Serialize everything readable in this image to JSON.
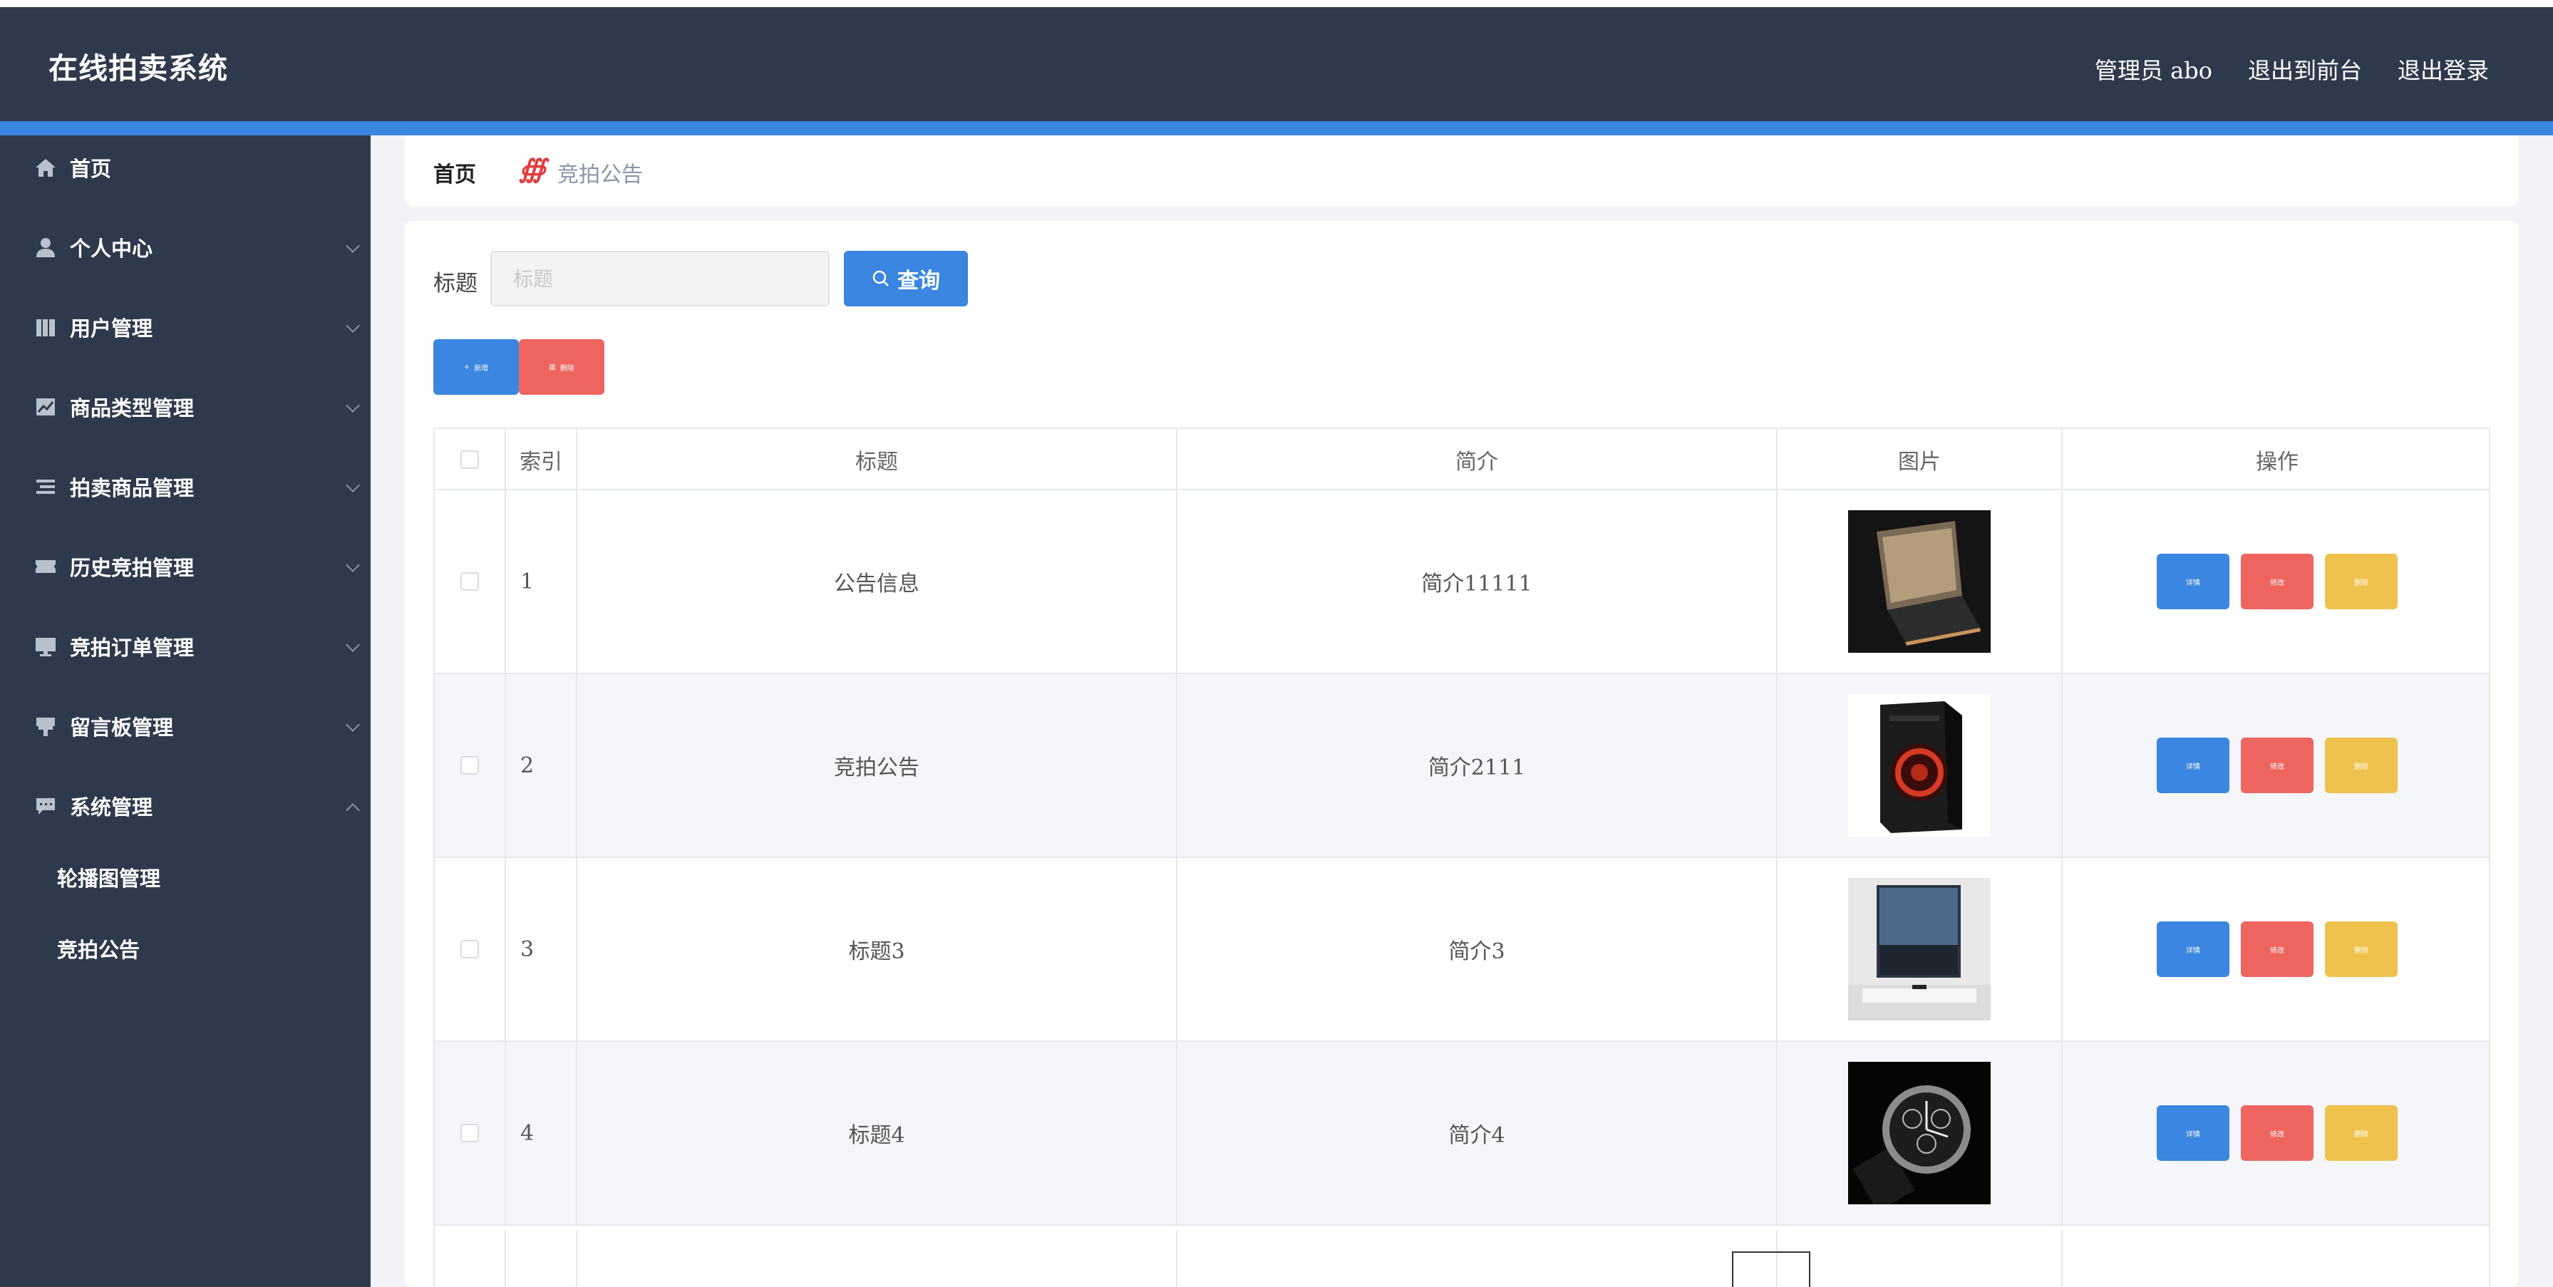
{
  "header": {
    "app_title": "在线拍卖系统",
    "admin_label": "管理员 abo",
    "exit_front_label": "退出到前台",
    "logout_label": "退出登录"
  },
  "sidebar": {
    "items": [
      {
        "label": "首页",
        "icon": "home-icon",
        "has_arrow": false
      },
      {
        "label": "个人中心",
        "icon": "user-icon",
        "has_arrow": true
      },
      {
        "label": "用户管理",
        "icon": "users-icon",
        "has_arrow": true
      },
      {
        "label": "商品类型管理",
        "icon": "chart-icon",
        "has_arrow": true
      },
      {
        "label": "拍卖商品管理",
        "icon": "list-icon",
        "has_arrow": true
      },
      {
        "label": "历史竞拍管理",
        "icon": "ticket-icon",
        "has_arrow": true
      },
      {
        "label": "竞拍订单管理",
        "icon": "monitor-icon",
        "has_arrow": true
      },
      {
        "label": "留言板管理",
        "icon": "board-icon",
        "has_arrow": true
      },
      {
        "label": "系统管理",
        "icon": "message-icon",
        "has_arrow": true,
        "expanded": true
      }
    ],
    "sub_items": [
      {
        "label": "轮播图管理"
      },
      {
        "label": "竞拍公告"
      }
    ]
  },
  "breadcrumb": {
    "home": "首页",
    "separator": "∰",
    "current": "竞拍公告"
  },
  "search": {
    "label": "标题",
    "placeholder": "标题",
    "button_label": "查询"
  },
  "toolbar": {
    "add_label": "新增",
    "delete_label": "删除"
  },
  "table": {
    "headers": [
      "索引",
      "标题",
      "简介",
      "图片",
      "操作"
    ],
    "rows": [
      {
        "index": "1",
        "title": "公告信息",
        "intro": "简介11111",
        "image": "laptop"
      },
      {
        "index": "2",
        "title": "竞拍公告",
        "intro": "简介2111",
        "image": "pc-case"
      },
      {
        "index": "3",
        "title": "标题3",
        "intro": "简介3",
        "image": "tv"
      },
      {
        "index": "4",
        "title": "标题4",
        "intro": "简介4",
        "image": "watch"
      }
    ],
    "op_labels": {
      "detail": "详情",
      "edit": "修改",
      "delete": "删除"
    }
  },
  "colors": {
    "header_bg": "#2e3a4c",
    "accent_blue": "#3a86e0",
    "danger_red": "#ee6560",
    "warning_yellow": "#efc24e"
  }
}
